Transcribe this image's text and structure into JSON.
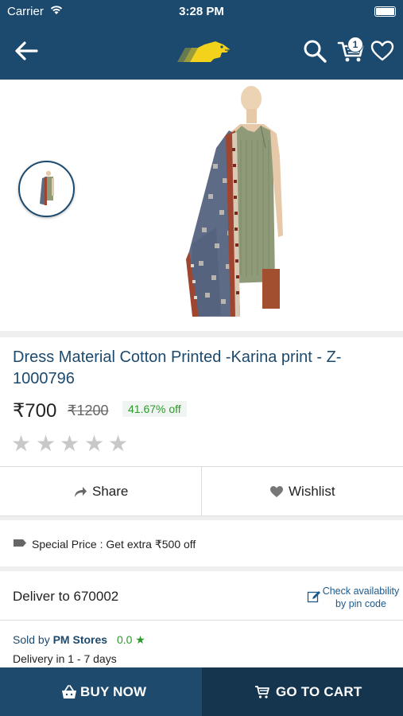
{
  "status_bar": {
    "carrier": "Carrier",
    "time": "3:28 PM"
  },
  "nav": {
    "cart_count": "1"
  },
  "product": {
    "title": "Dress Material Cotton Printed  -Karina print - Z-1000796",
    "price": "₹700",
    "mrp": "₹1200",
    "discount": "41.67% off",
    "rating_stars": 0,
    "max_stars": 5
  },
  "actions": {
    "share_label": "Share",
    "wishlist_label": "Wishlist"
  },
  "offer": {
    "text": "Special Price : Get extra ₹500 off"
  },
  "delivery": {
    "deliver_to": "Deliver to 670002",
    "check_line1": "Check availability",
    "check_line2": "by pin code"
  },
  "seller": {
    "sold_by_label": "Sold by",
    "store_name": "PM Stores",
    "rating": "0.0 ★",
    "delivery_time": "Delivery in 1 - 7 days"
  },
  "bottom_bar": {
    "buy_now_label": "BUY NOW",
    "go_to_cart_label": "GO TO CART"
  },
  "colors": {
    "brand_blue": "#1c4a6e",
    "dark_blue": "#15344d",
    "discount_green": "#2b9a2b",
    "logo_yellow": "#f2d21b"
  }
}
